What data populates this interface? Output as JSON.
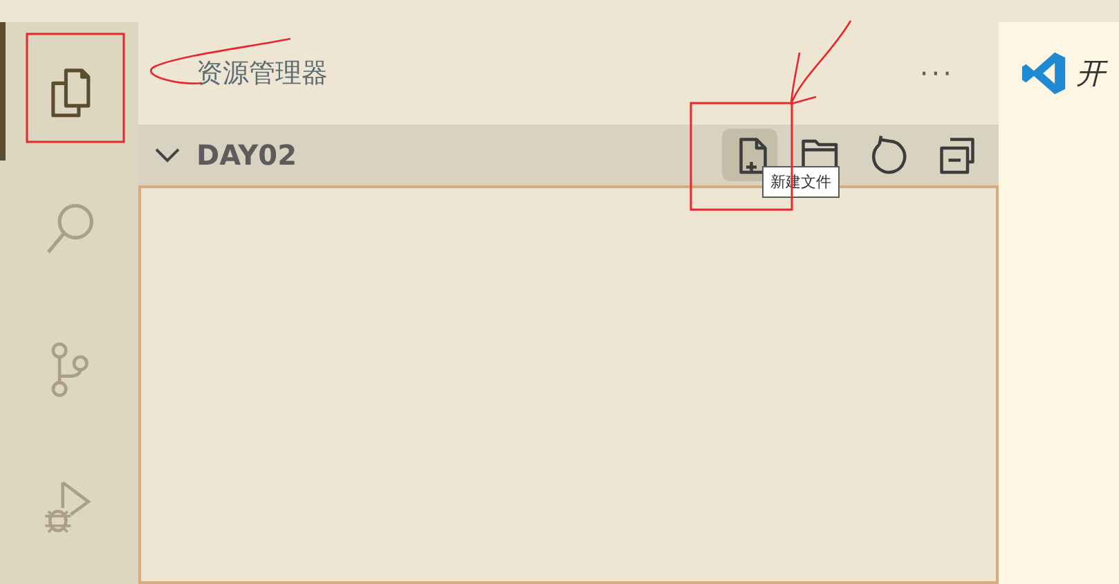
{
  "activity_bar": {
    "items": [
      {
        "kind": "explorer",
        "selected": true
      },
      {
        "kind": "search",
        "selected": false
      },
      {
        "kind": "source-control",
        "selected": false
      },
      {
        "kind": "run-debug",
        "selected": false
      }
    ]
  },
  "sidebar": {
    "title": "资源管理器",
    "more": "···",
    "section": {
      "title": "DAY02",
      "expanded": true,
      "actions": [
        {
          "kind": "new-file",
          "hovered": true
        },
        {
          "kind": "new-folder",
          "hovered": false
        },
        {
          "kind": "refresh",
          "hovered": false
        },
        {
          "kind": "collapse",
          "hovered": false
        }
      ],
      "tooltip": "新建文件"
    }
  },
  "editor": {
    "tab_title": "开"
  }
}
